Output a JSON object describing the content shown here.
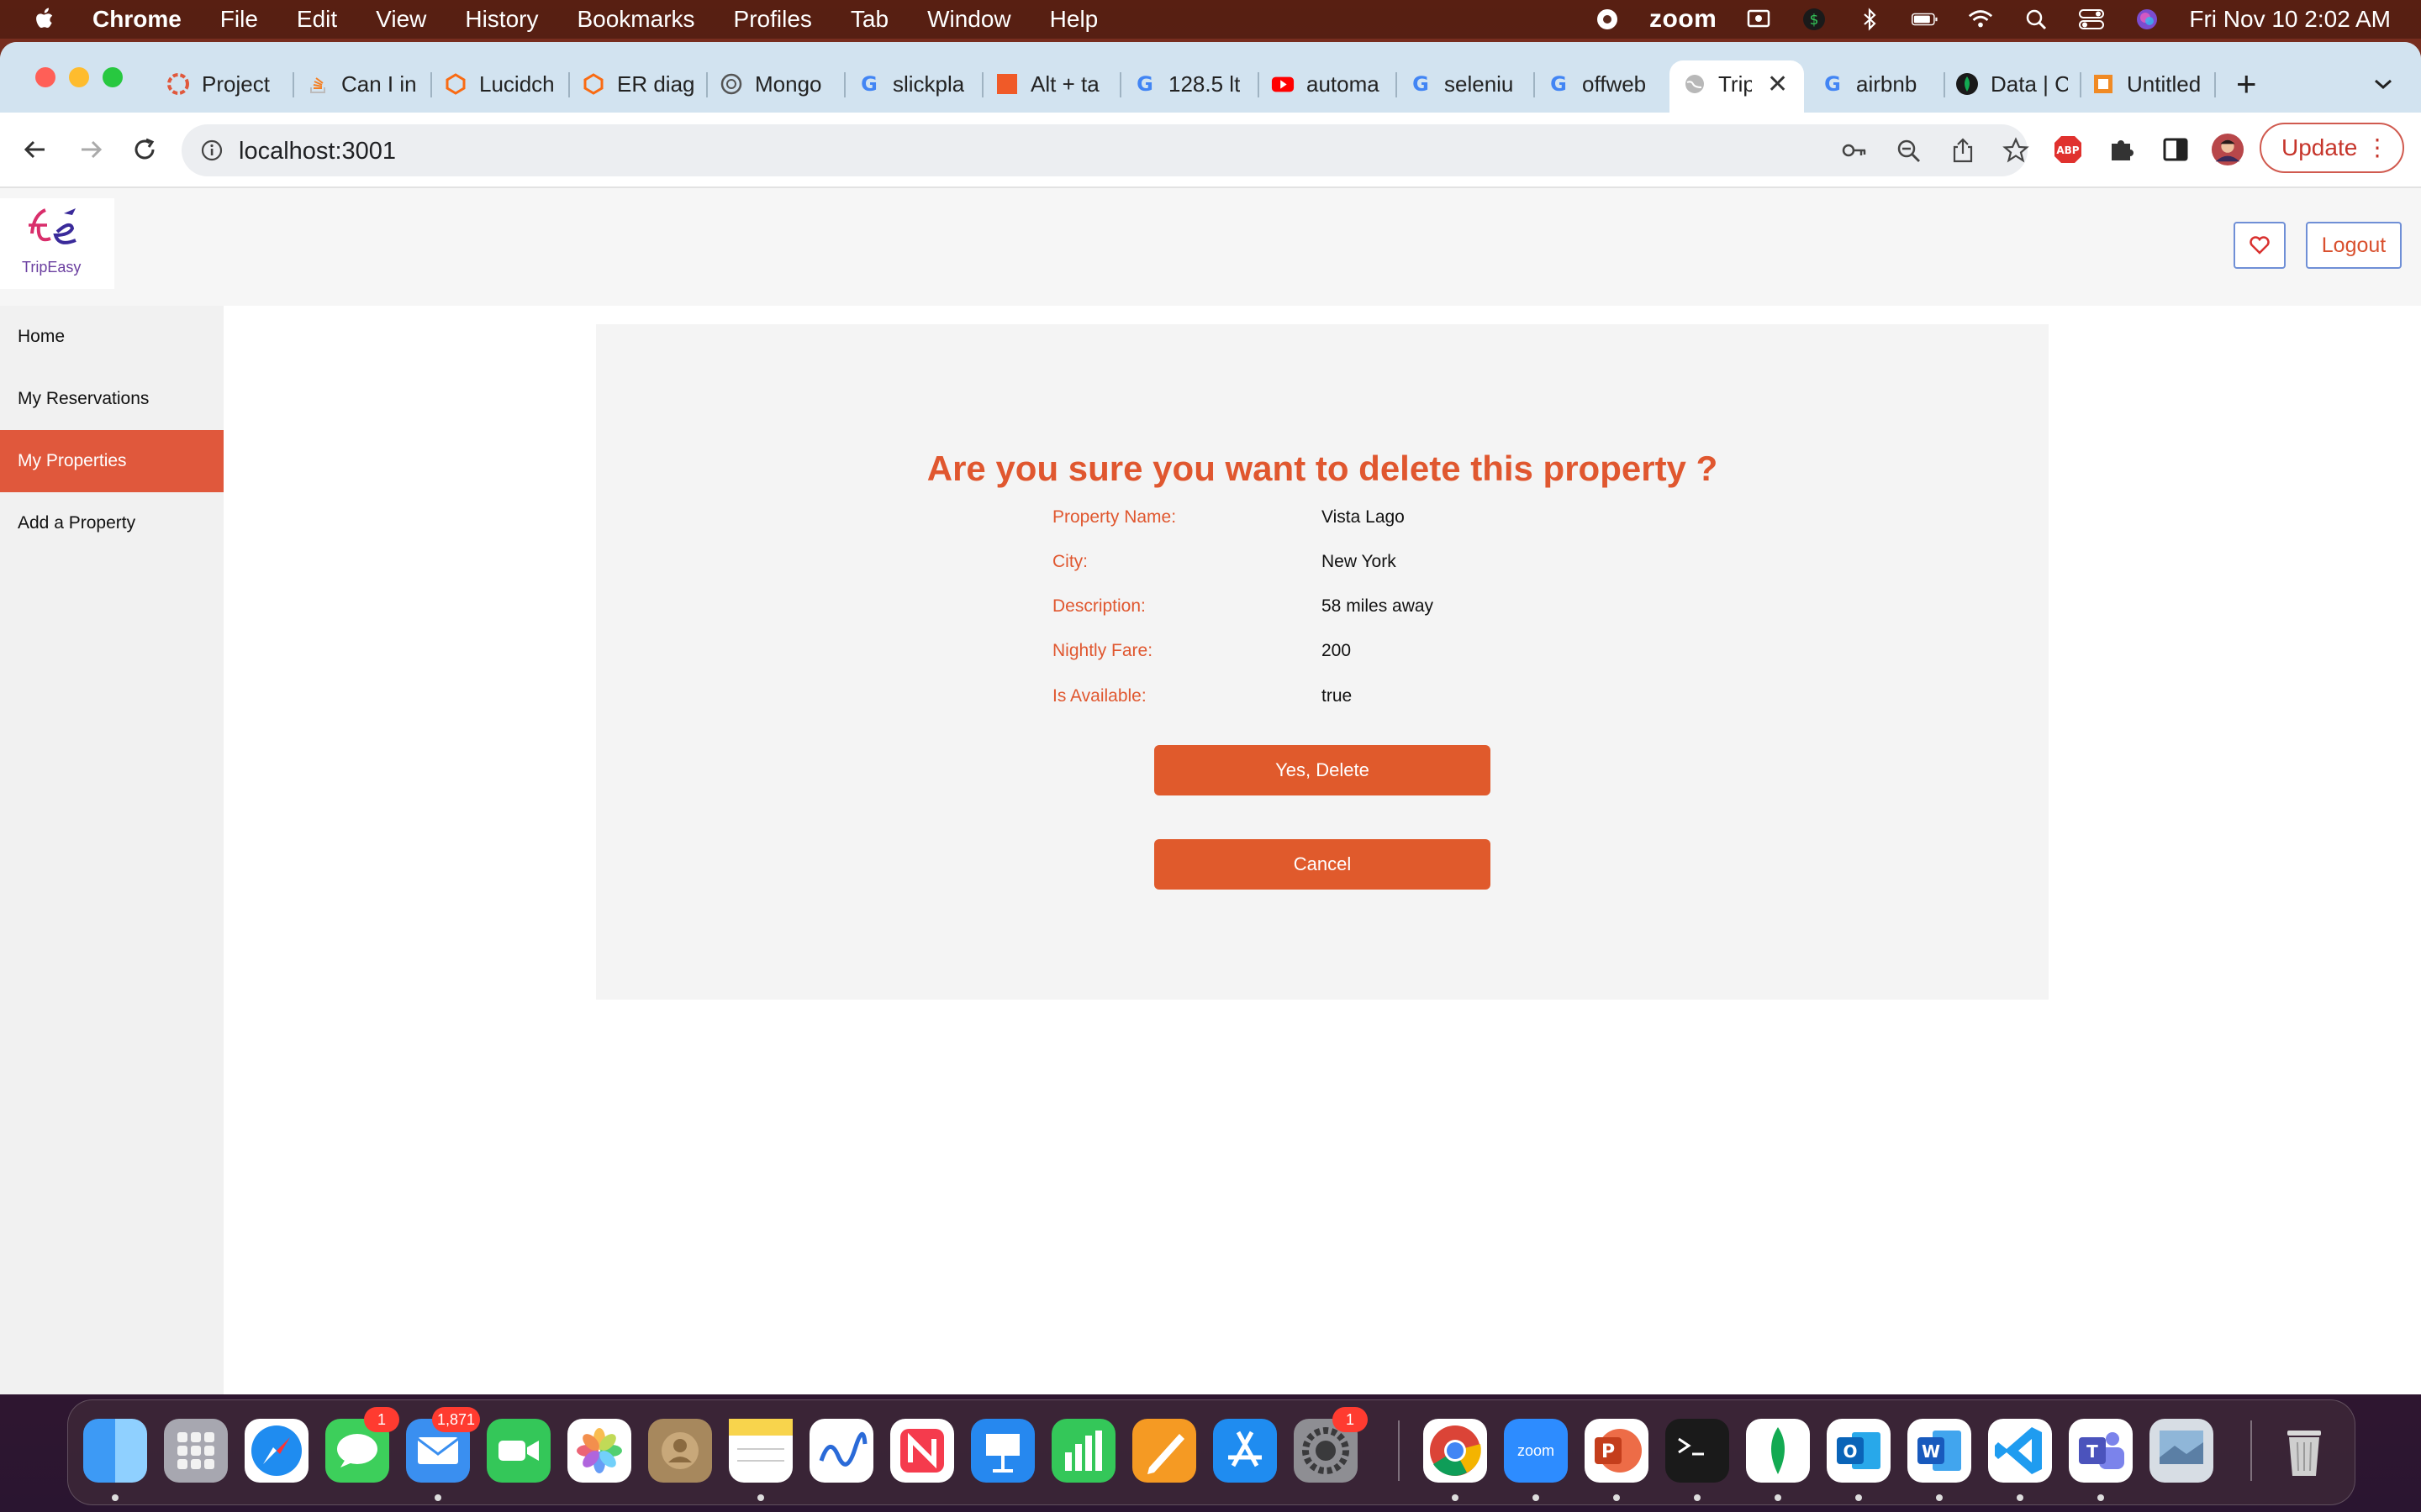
{
  "menubar": {
    "items": [
      "Chrome",
      "File",
      "Edit",
      "View",
      "History",
      "Bookmarks",
      "Profiles",
      "Tab",
      "Window",
      "Help"
    ],
    "zoom_label": "zoom",
    "clock": "Fri Nov 10  2:02 AM"
  },
  "browser": {
    "tabs": [
      {
        "label": "Project",
        "icon": "project-icon"
      },
      {
        "label": "Can I in",
        "icon": "stackoverflow-icon"
      },
      {
        "label": "Lucidch",
        "icon": "lucid-icon"
      },
      {
        "label": "ER diag",
        "icon": "lucid-icon"
      },
      {
        "label": "Mongo",
        "icon": "openai-icon"
      },
      {
        "label": "slickpla",
        "icon": "google-icon"
      },
      {
        "label": "Alt + ta",
        "icon": "orange-square-icon"
      },
      {
        "label": "128.5 lt",
        "icon": "google-icon"
      },
      {
        "label": "automa",
        "icon": "youtube-icon"
      },
      {
        "label": "seleniu",
        "icon": "google-icon"
      },
      {
        "label": "offweb",
        "icon": "google-icon"
      },
      {
        "label": "Trip",
        "icon": "globe-icon",
        "active": true
      },
      {
        "label": "airbnb",
        "icon": "google-icon"
      },
      {
        "label": "Data | C",
        "icon": "mongodb-icon"
      },
      {
        "label": "Untitled",
        "icon": "figma-icon"
      }
    ],
    "url": "localhost:3001",
    "update_label": "Update"
  },
  "site": {
    "logo_text": "TripEasy",
    "logout_label": "Logout",
    "sidebar": [
      {
        "label": "Home",
        "active": false
      },
      {
        "label": "My Reservations",
        "active": false
      },
      {
        "label": "My Properties",
        "active": true
      },
      {
        "label": "Add a Property",
        "active": false
      }
    ]
  },
  "dialog": {
    "title": "Are you sure you want to delete this property ?",
    "fields": [
      {
        "label": "Property Name:",
        "value": "Vista Lago"
      },
      {
        "label": "City:",
        "value": "New York"
      },
      {
        "label": "Description:",
        "value": "58 miles away"
      },
      {
        "label": "Nightly Fare:",
        "value": "200"
      },
      {
        "label": "Is Available:",
        "value": "true"
      }
    ],
    "confirm_label": "Yes, Delete",
    "cancel_label": "Cancel"
  },
  "dock": {
    "messages_badge": "1",
    "mail_badge": "1,871",
    "settings_badge": "1",
    "zoom_label": "zoom"
  },
  "colors": {
    "accent": "#e0572f",
    "button": "#e05a2c",
    "sidebar_active": "#e0583c",
    "tabbar": "#d2e3f0"
  }
}
